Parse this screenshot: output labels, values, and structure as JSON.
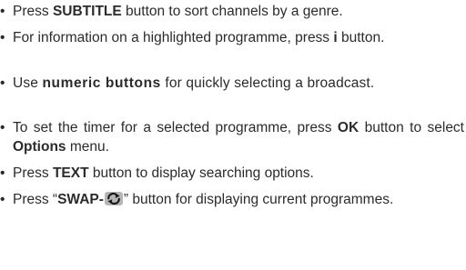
{
  "bullet_char": "•",
  "items": [
    {
      "pre": "Press ",
      "b1": "SUBTITLE",
      "post": " button to sort channels by a genre."
    },
    {
      "pre": "For information on a highlighted programme, press ",
      "b1": "i",
      "post": " button."
    },
    {
      "pre": "Use ",
      "b1": "numeric buttons",
      "post": " for quickly selecting a broadcast."
    },
    {
      "pre": "To set the timer for a selected programme, press ",
      "b1": "OK",
      "mid": " button to select ",
      "b2": "Options",
      "post": " menu."
    },
    {
      "pre": "Press ",
      "b1": "TEXT",
      "post": " button to display searching options."
    },
    {
      "pre": "Press “",
      "b1": "SWAP-",
      "post": "” button for displaying current programmes.",
      "icon": "swap-icon"
    }
  ]
}
